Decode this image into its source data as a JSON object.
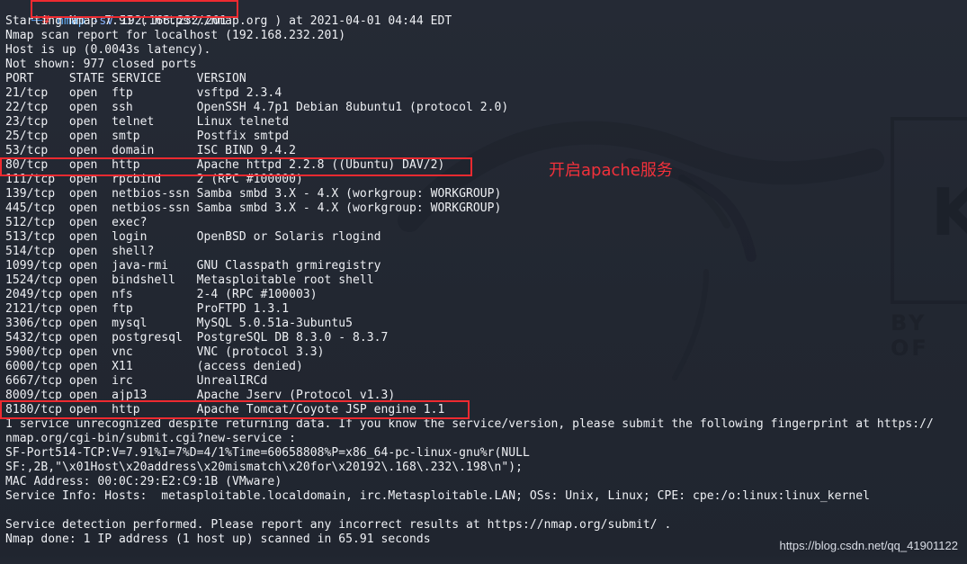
{
  "terminal": {
    "prompt": {
      "corner": "└─",
      "hash": "#",
      "command_name": "nmap",
      "command_flag": "-sV",
      "command_target": "192.168.232.201"
    },
    "lines": [
      "Starting Nmap 7.91 ( https://nmap.org ) at 2021-04-01 04:44 EDT",
      "Nmap scan report for localhost (192.168.232.201)",
      "Host is up (0.0043s latency).",
      "Not shown: 977 closed ports",
      "PORT     STATE SERVICE     VERSION",
      "21/tcp   open  ftp         vsftpd 2.3.4",
      "22/tcp   open  ssh         OpenSSH 4.7p1 Debian 8ubuntu1 (protocol 2.0)",
      "23/tcp   open  telnet      Linux telnetd",
      "25/tcp   open  smtp        Postfix smtpd",
      "53/tcp   open  domain      ISC BIND 9.4.2",
      "80/tcp   open  http        Apache httpd 2.2.8 ((Ubuntu) DAV/2)",
      "111/tcp  open  rpcbind     2 (RPC #100000)",
      "139/tcp  open  netbios-ssn Samba smbd 3.X - 4.X (workgroup: WORKGROUP)",
      "445/tcp  open  netbios-ssn Samba smbd 3.X - 4.X (workgroup: WORKGROUP)",
      "512/tcp  open  exec?",
      "513/tcp  open  login       OpenBSD or Solaris rlogind",
      "514/tcp  open  shell?",
      "1099/tcp open  java-rmi    GNU Classpath grmiregistry",
      "1524/tcp open  bindshell   Metasploitable root shell",
      "2049/tcp open  nfs         2-4 (RPC #100003)",
      "2121/tcp open  ftp         ProFTPD 1.3.1",
      "3306/tcp open  mysql       MySQL 5.0.51a-3ubuntu5",
      "5432/tcp open  postgresql  PostgreSQL DB 8.3.0 - 8.3.7",
      "5900/tcp open  vnc         VNC (protocol 3.3)",
      "6000/tcp open  X11         (access denied)",
      "6667/tcp open  irc         UnrealIRCd",
      "8009/tcp open  ajp13       Apache Jserv (Protocol v1.3)",
      "8180/tcp open  http        Apache Tomcat/Coyote JSP engine 1.1",
      "1 service unrecognized despite returning data. If you know the service/version, please submit the following fingerprint at https://",
      "nmap.org/cgi-bin/submit.cgi?new-service :",
      "SF-Port514-TCP:V=7.91%I=7%D=4/1%Time=60658808%P=x86_64-pc-linux-gnu%r(NULL",
      "SF:,2B,\"\\x01Host\\x20address\\x20mismatch\\x20for\\x20192\\.168\\.232\\.198\\n\");",
      "MAC Address: 00:0C:29:E2:C9:1B (VMware)",
      "Service Info: Hosts:  metasploitable.localdomain, irc.Metasploitable.LAN; OSs: Unix, Linux; CPE: cpe:/o:linux:linux_kernel",
      "",
      "Service detection performed. Please report any incorrect results at https://nmap.org/submit/ .",
      "Nmap done: 1 IP address (1 host up) scanned in 65.91 seconds"
    ]
  },
  "annotation": {
    "text": "开启apache服务"
  },
  "watermark": {
    "text": "https://blog.csdn.net/qq_41901122"
  },
  "background_marks": {
    "label_top": "K",
    "label_bottom": "BY OF"
  },
  "colors": {
    "annotation_red": "#ee2a30",
    "terminal_bg": "#232833",
    "text": "#eef0f4",
    "command_blue": "#69b7ff"
  }
}
